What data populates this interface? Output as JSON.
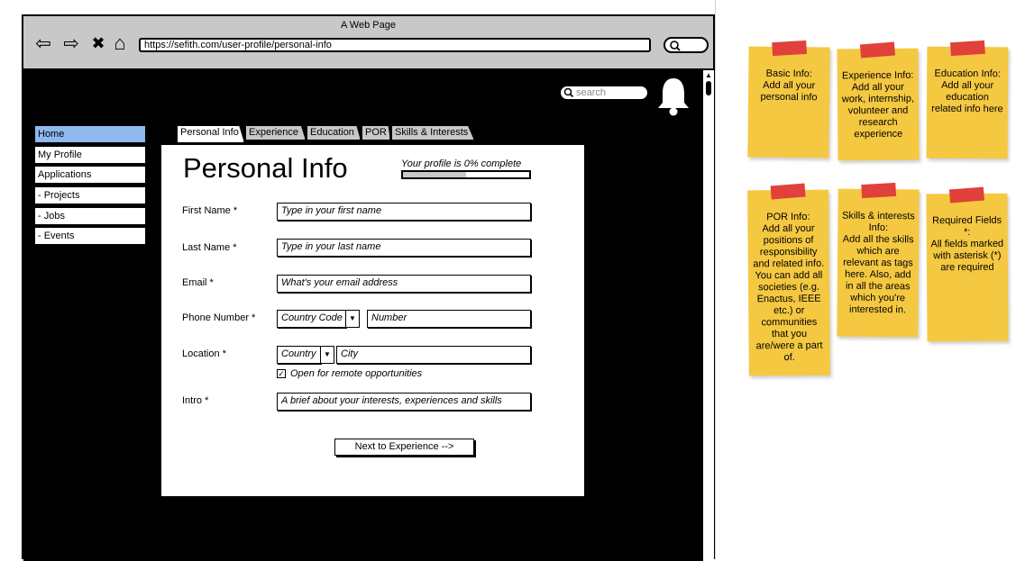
{
  "window": {
    "title": "A Web Page",
    "url": "https://sefith.com/user-profile/personal-info"
  },
  "toolbar": {
    "back": "⇦",
    "forward": "⇨",
    "close": "✖",
    "home": "⌂"
  },
  "header": {
    "search_placeholder": "search"
  },
  "sidebar": {
    "items": [
      {
        "label": "Home",
        "active": true
      },
      {
        "label": "My Profile"
      },
      {
        "label": "Applications"
      },
      {
        "label": " - Projects"
      },
      {
        "label": " - Jobs"
      },
      {
        "label": " - Events"
      }
    ]
  },
  "tabs": [
    {
      "label": "Personal Info",
      "active": true
    },
    {
      "label": "Experience"
    },
    {
      "label": "Education"
    },
    {
      "label": "POR"
    },
    {
      "label": "Skills & Interests"
    }
  ],
  "form": {
    "title": "Personal Info",
    "progress_text": "Your profile is 0% complete",
    "progress_fraction": 0,
    "first_name_label": "First Name *",
    "first_name_placeholder": "Type in your first name",
    "last_name_label": "Last Name *",
    "last_name_placeholder": "Type in your last name",
    "email_label": "Email *",
    "email_placeholder": "What's your email address",
    "phone_label": "Phone Number *",
    "country_code": "Country Code",
    "number_placeholder": "Number",
    "location_label": "Location *",
    "country": "Country",
    "city_placeholder": "City",
    "remote_label": "Open for remote opportunities",
    "remote_checked": true,
    "intro_label": "Intro *",
    "intro_placeholder": "A brief about your interests, experiences and skills",
    "next_button": "Next to Experience -->"
  },
  "notes": {
    "basic": "Basic Info:\nAdd all your personal info",
    "experience": "Experience Info:\nAdd all your work, internship, volunteer and research experience",
    "education": "Education Info:\nAdd all your education related info here",
    "por": "POR Info:\nAdd all your positions of responsibility and related info.\nYou can add all societies (e.g. Enactus, IEEE etc.) or communities that you are/were a part of.",
    "skills": "Skills & interests Info:\nAdd all the skills which are relevant as tags here. Also, add in all the areas which you're interested in.",
    "required": "Required Fields *:\nAll fields marked with asterisk (*) are required"
  },
  "colors": {
    "note": "#f5c842",
    "tape": "#e0413a",
    "active_nav": "#8fb8ef",
    "chrome": "#c8c8c8"
  }
}
